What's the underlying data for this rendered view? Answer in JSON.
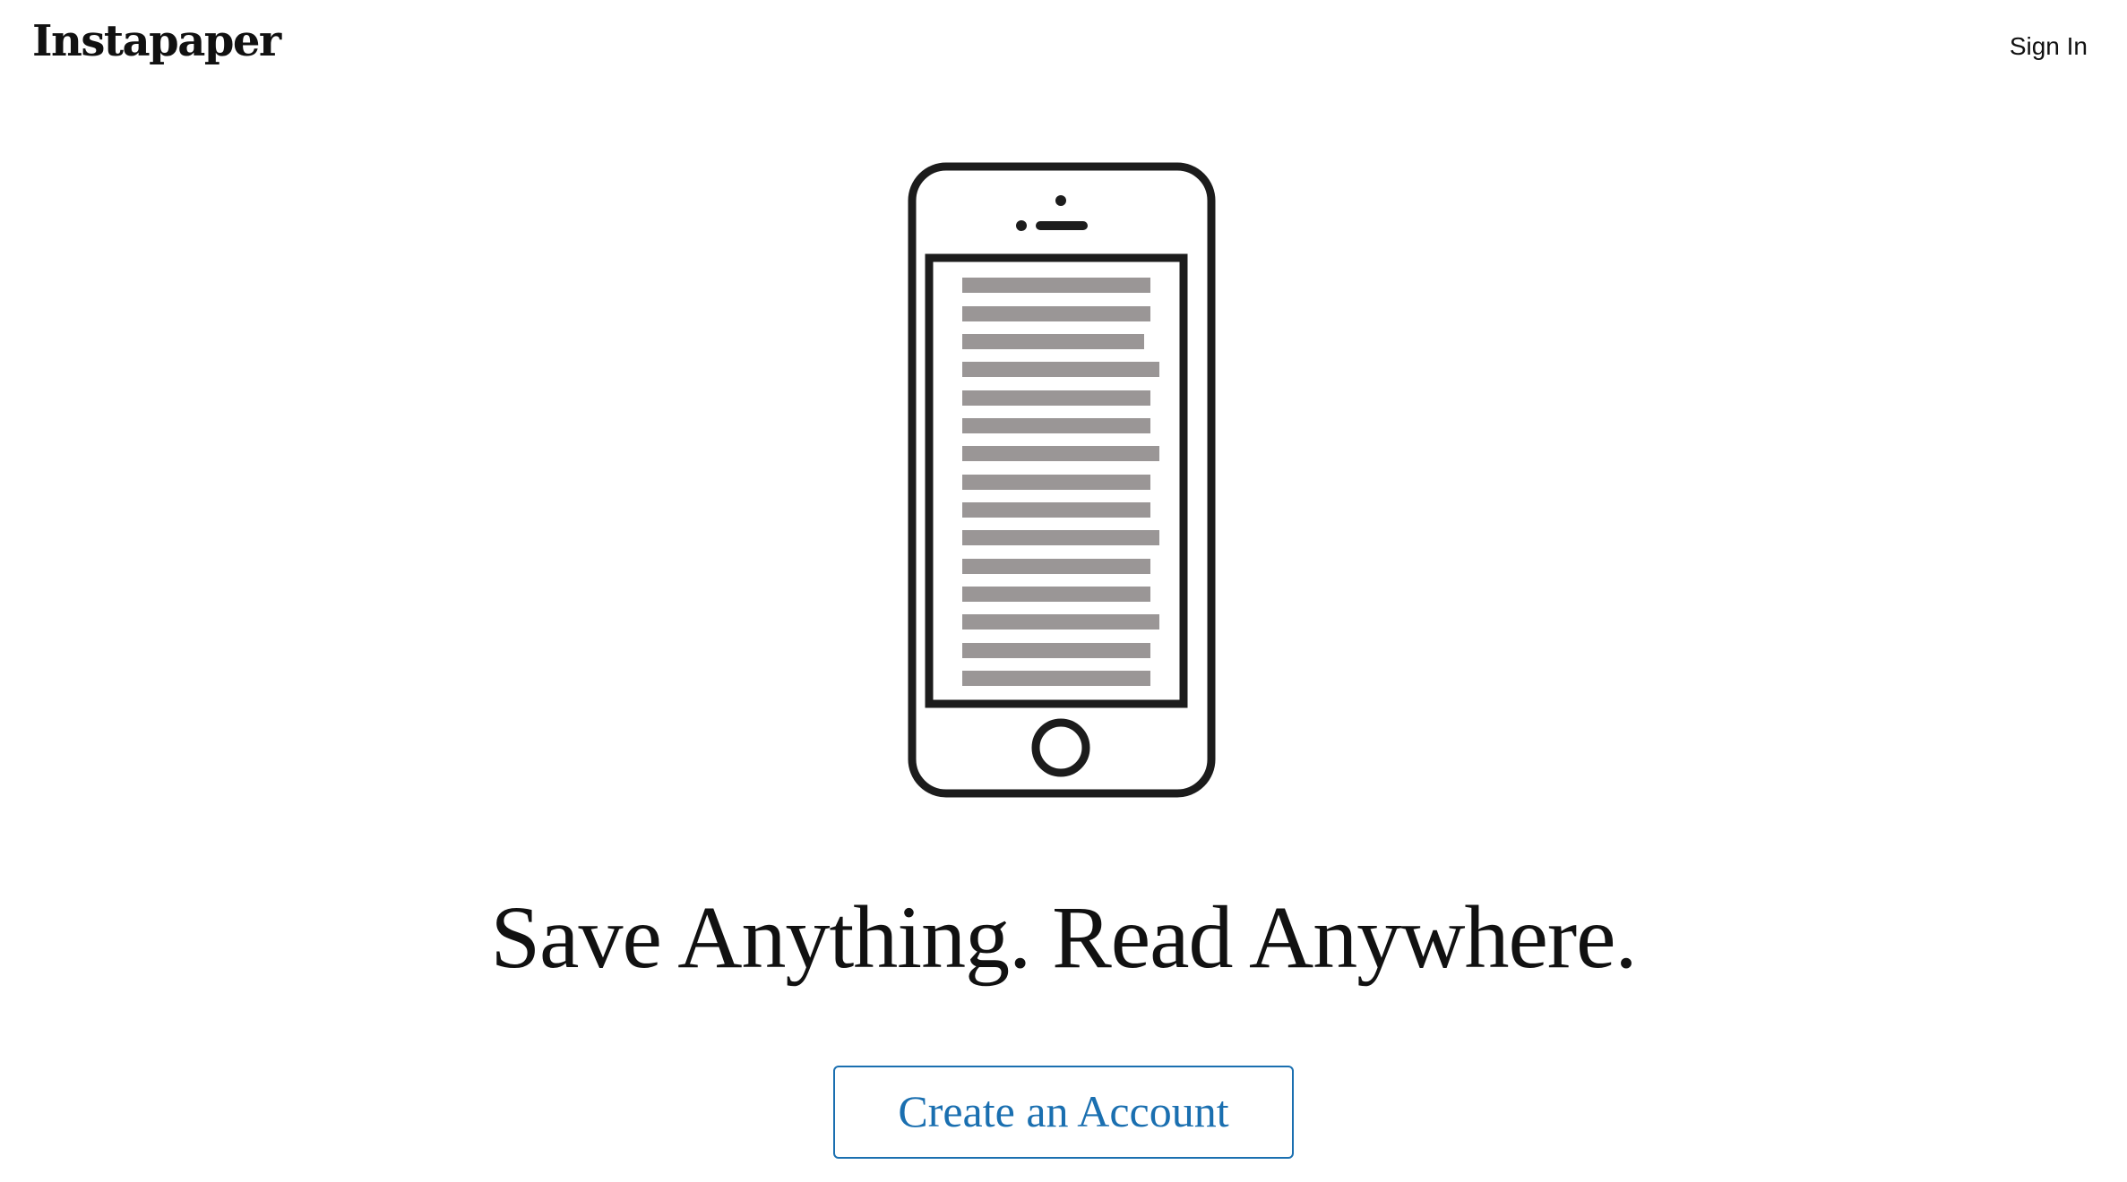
{
  "header": {
    "logo_text": "Instapaper",
    "sign_in_label": "Sign In"
  },
  "hero": {
    "illustration_icon": "phone-reading-icon",
    "headline": "Save Anything. Read Anywhere.",
    "cta_label": "Create an Account"
  },
  "colors": {
    "text": "#111111",
    "accent": "#1a6fb0",
    "phone_outline": "#1c1c1c",
    "text_line_gray": "#9a9696",
    "background": "#ffffff"
  }
}
